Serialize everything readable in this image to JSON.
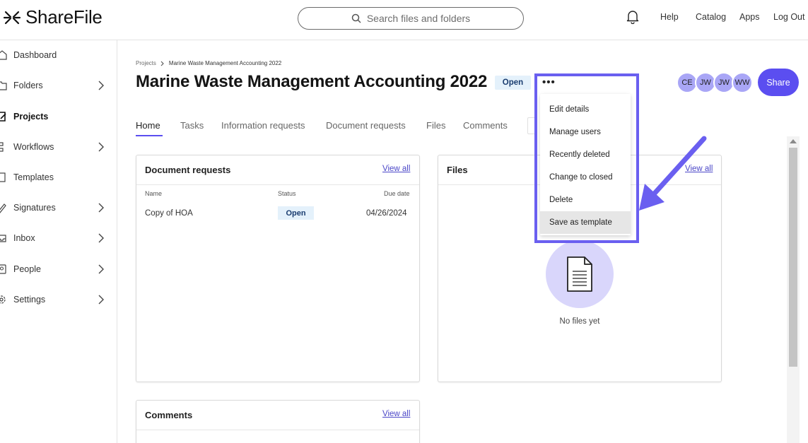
{
  "app": {
    "name": "ShareFile"
  },
  "search": {
    "placeholder": "Search files and folders"
  },
  "header_links": [
    "Help",
    "Catalog",
    "Apps",
    "Log Out"
  ],
  "sidebar": {
    "items": [
      {
        "label": "Dashboard",
        "icon": "home-icon",
        "chevron": false
      },
      {
        "label": "Folders",
        "icon": "folder-icon",
        "chevron": true
      },
      {
        "label": "Projects",
        "icon": "projects-icon",
        "chevron": false,
        "active": true
      },
      {
        "label": "Workflows",
        "icon": "workflow-icon",
        "chevron": true
      },
      {
        "label": "Templates",
        "icon": "template-icon",
        "chevron": false
      },
      {
        "label": "Signatures",
        "icon": "signature-icon",
        "chevron": true
      },
      {
        "label": "Inbox",
        "icon": "inbox-icon",
        "chevron": true
      },
      {
        "label": "People",
        "icon": "people-icon",
        "chevron": true
      },
      {
        "label": "Settings",
        "icon": "gear-icon",
        "chevron": true
      }
    ]
  },
  "breadcrumb": {
    "parent": "Projects",
    "current": "Marine Waste Management Accounting 2022"
  },
  "project": {
    "title": "Marine Waste Management Accounting 2022",
    "status": "Open",
    "more_label": "•••"
  },
  "members": [
    "CE",
    "JW",
    "JW",
    "WW"
  ],
  "share_label": "Share",
  "tabs": [
    "Home",
    "Tasks",
    "Information requests",
    "Document requests",
    "Files",
    "Comments"
  ],
  "doc_requests": {
    "title": "Document requests",
    "view_all": "View all",
    "columns": {
      "name": "Name",
      "status": "Status",
      "due": "Due date"
    },
    "rows": [
      {
        "name": "Copy of HOA",
        "status": "Open",
        "due": "04/26/2024"
      }
    ]
  },
  "files": {
    "title": "Files",
    "view_all": "View all",
    "empty": "No files yet"
  },
  "comments": {
    "title": "Comments",
    "view_all": "View all"
  },
  "menu": {
    "items": [
      "Edit details",
      "Manage users",
      "Recently deleted",
      "Change to closed",
      "Delete",
      "Save as template"
    ],
    "highlighted": "Save as template"
  },
  "colors": {
    "accent": "#5b4ef0",
    "highlight_box": "#6a5ff0",
    "avatar": "#a9a6f6",
    "status_bg": "#e4f1fb"
  }
}
